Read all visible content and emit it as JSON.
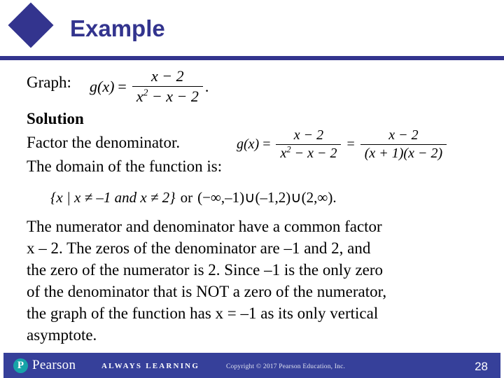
{
  "header": {
    "title": "Example",
    "accent_color": "#33348e",
    "bullet_icon": "diamond-icon"
  },
  "body": {
    "graph_label": "Graph:",
    "solution_heading": "Solution",
    "factor_instruction": "Factor the denominator.",
    "domain_lead": "The domain of the function is:",
    "paragraph_lines": [
      "The numerator and denominator have a common factor",
      "x – 2. The zeros of the denominator are –1 and 2, and",
      "the zero of the numerator is 2. Since –1 is the only zero",
      "of the denominator that is NOT a zero of the numerator,",
      "the graph of the function has x = –1 as its only vertical",
      "asymptote."
    ]
  },
  "math": {
    "eq1": {
      "lhs": "g(x)",
      "equals": "=",
      "numerator": "x − 2",
      "denominator": "x² − x − 2",
      "trailing": ".",
      "plain": "g(x) = (x − 2)/(x² − x − 2)."
    },
    "eq2": {
      "lhs": "g(x)",
      "equals1": "=",
      "numerator1": "x − 2",
      "denominator1": "x² − x − 2",
      "equals2": "=",
      "numerator2": "x − 2",
      "denominator2": "(x + 1)(x − 2)",
      "plain": "g(x) = (x − 2)/(x² − x − 2) = (x − 2)/((x + 1)(x − 2))"
    },
    "eq3": {
      "set_builder": "{x | x ≠ –1 and x ≠ 2}",
      "or": "or",
      "interval": "(−∞,–1)∪(–1,2)∪(2,∞).",
      "plain": "{x | x ≠ –1 and x ≠ 2} or (−∞,–1)∪(–1,2)∪(2,∞)."
    }
  },
  "footer": {
    "brand": "Pearson",
    "brand_mark_letter": "P",
    "brand_mark_color": "#17a3a8",
    "tagline": "ALWAYS LEARNING",
    "copyright": "Copyright © 2017 Pearson Education, Inc.",
    "page_number": "28",
    "background_color": "#36409a"
  }
}
